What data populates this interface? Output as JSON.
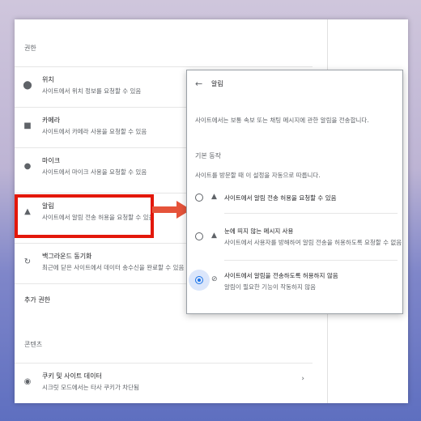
{
  "permissions": {
    "section_title": "권한",
    "rows": [
      {
        "title": "위치",
        "desc": "사이트에서 위치 정보를 요청할 수 있음",
        "icon": "location-pin-icon"
      },
      {
        "title": "카메라",
        "desc": "사이트에서 카메라 사용을 요청할 수 있음",
        "icon": "camera-icon"
      },
      {
        "title": "마이크",
        "desc": "사이트에서 마이크 사용을 요청할 수 있음",
        "icon": "microphone-icon"
      },
      {
        "title": "알림",
        "desc": "사이트에서 알림 전송 허용을 요청할 수 있음",
        "icon": "bell-icon"
      },
      {
        "title": "백그라운드 동기화",
        "desc": "최근에 닫은 사이트에서 데이터 송수신을 완료할 수 있음",
        "icon": "sync-icon"
      }
    ],
    "additional": "추가 권한"
  },
  "content": {
    "section_title": "콘텐츠",
    "cookies_title": "쿠키 및 사이트 데이터",
    "cookies_desc": "시크릿 모드에서는 타사 쿠키가 차단됨"
  },
  "popup": {
    "title": "알림",
    "description": "사이트에서는 보통 속보 또는 채팅 메시지에 관한 알림을 전송합니다.",
    "default_behavior": "기본 동작",
    "default_desc": "사이트를 방문할 때 이 설정을 자동으로 따릅니다.",
    "options": [
      {
        "title": "사이트에서 알림 전송 허용을 요청할 수 있음",
        "desc": "",
        "selected": false
      },
      {
        "title": "눈에 띄지 않는 메시지 사용",
        "desc": "사이트에서 사용자를 방해하여 알림 전송을 허용하도록 요청할 수 없음",
        "selected": false
      },
      {
        "title": "사이트에서 알림을 전송하도록 허용하지 않음",
        "desc": "알림이 필요한 기능이 작동하지 않음",
        "selected": true
      }
    ]
  },
  "colors": {
    "highlight": "#e3170a",
    "accent": "#1a73e8",
    "arrow": "#e5533a"
  }
}
